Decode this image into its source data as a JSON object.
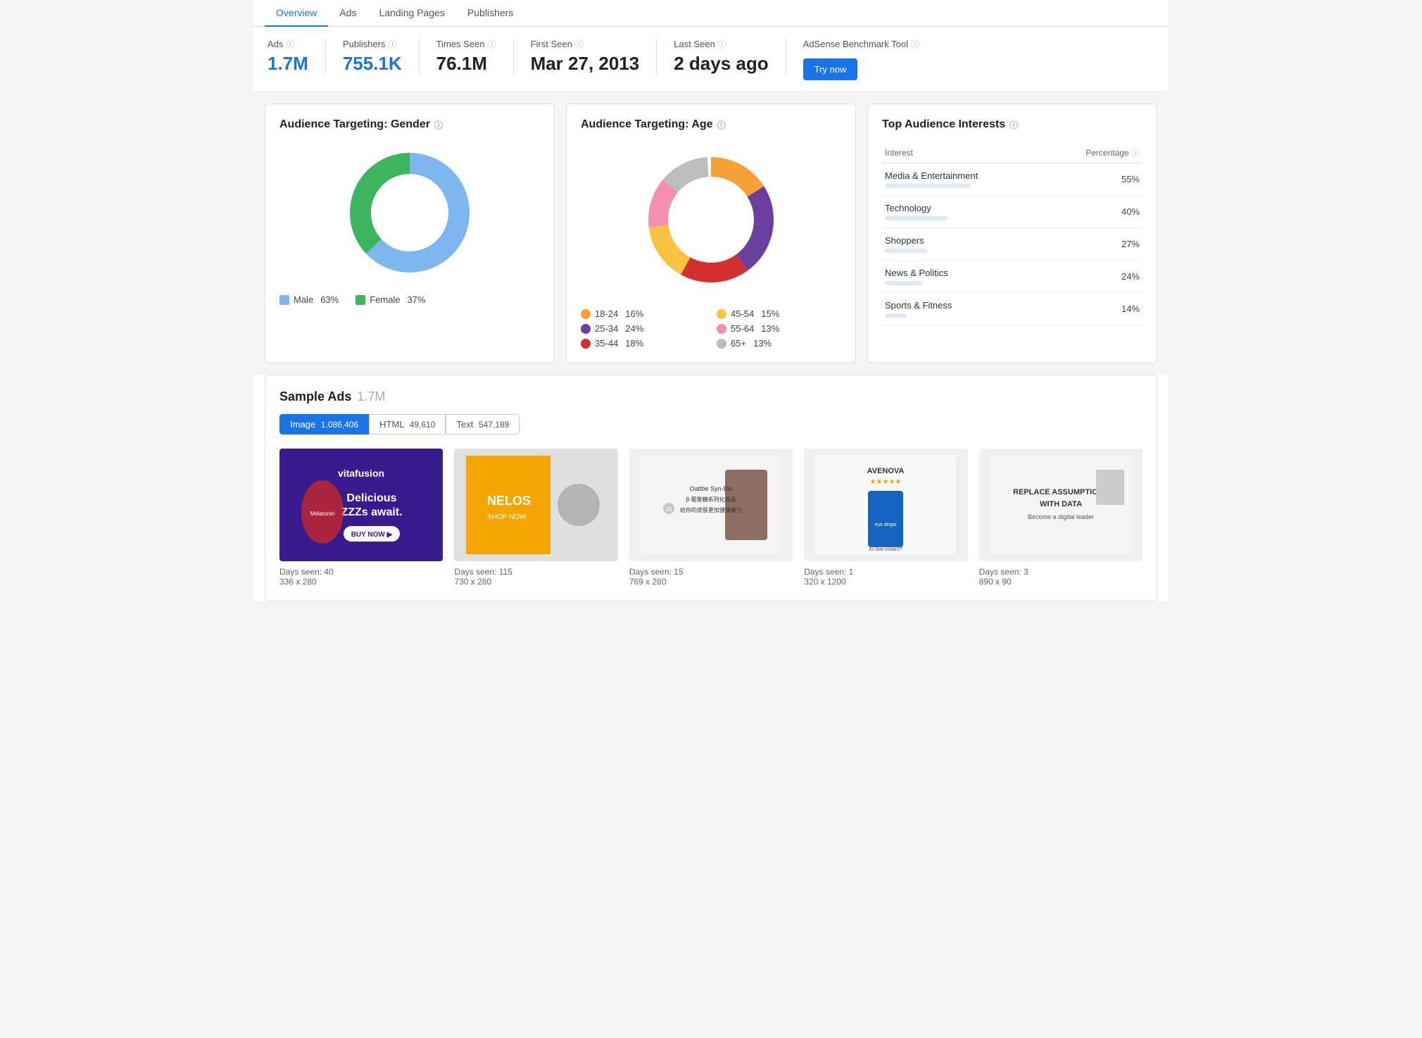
{
  "tabs": [
    {
      "id": "overview",
      "label": "Overview",
      "active": true
    },
    {
      "id": "ads",
      "label": "Ads",
      "active": false
    },
    {
      "id": "landing-pages",
      "label": "Landing Pages",
      "active": false
    },
    {
      "id": "publishers",
      "label": "Publishers",
      "active": false
    }
  ],
  "stats": {
    "ads": {
      "label": "Ads",
      "value": "1.7M"
    },
    "publishers": {
      "label": "Publishers",
      "value": "755.1K"
    },
    "times_seen": {
      "label": "Times Seen",
      "value": "76.1M"
    },
    "first_seen": {
      "label": "First Seen",
      "value": "Mar 27, 2013"
    },
    "last_seen": {
      "label": "Last Seen",
      "value": "2 days ago"
    },
    "adsense": {
      "label": "AdSense Benchmark Tool",
      "button": "Try now"
    }
  },
  "gender_chart": {
    "title": "Audience Targeting: Gender",
    "segments": [
      {
        "label": "Male",
        "pct": 63,
        "color": "#7eb6f0"
      },
      {
        "label": "Female",
        "pct": 37,
        "color": "#3db55e"
      }
    ]
  },
  "age_chart": {
    "title": "Audience Targeting: Age",
    "segments": [
      {
        "label": "18-24",
        "pct": 16,
        "color": "#f4a235"
      },
      {
        "label": "25-34",
        "pct": 24,
        "color": "#6b3fa0"
      },
      {
        "label": "35-44",
        "pct": 18,
        "color": "#d32f2f"
      },
      {
        "label": "45-54",
        "pct": 15,
        "color": "#f9c340"
      },
      {
        "label": "55-64",
        "pct": 13,
        "color": "#f48fb1"
      },
      {
        "label": "65+",
        "pct": 13,
        "color": "#bdbdbd"
      }
    ]
  },
  "interests": {
    "title": "Top Audience Interests",
    "col_interest": "Interest",
    "col_percentage": "Percentage",
    "items": [
      {
        "label": "Media & Entertainment",
        "pct": 55,
        "pct_label": "55%"
      },
      {
        "label": "Technology",
        "pct": 40,
        "pct_label": "40%"
      },
      {
        "label": "Shoppers",
        "pct": 27,
        "pct_label": "27%"
      },
      {
        "label": "News & Politics",
        "pct": 24,
        "pct_label": "24%"
      },
      {
        "label": "Sports & Fitness",
        "pct": 14,
        "pct_label": "14%"
      }
    ]
  },
  "sample_ads": {
    "title": "Sample Ads",
    "count": "1.7M",
    "filters": [
      {
        "label": "Image",
        "count": "1,086,406",
        "active": true
      },
      {
        "label": "HTML",
        "count": "49,610",
        "active": false
      },
      {
        "label": "Text",
        "count": "547,189",
        "active": false
      }
    ],
    "ads": [
      {
        "days_seen": "Days seen: 40",
        "dimensions": "336 x 280",
        "thumb_type": "vitafusion"
      },
      {
        "days_seen": "Days seen: 115",
        "dimensions": "730 x 280",
        "thumb_type": "gray"
      },
      {
        "days_seen": "Days seen: 15",
        "dimensions": "769 x 280",
        "thumb_type": "gray"
      },
      {
        "days_seen": "Days seen: 1",
        "dimensions": "320 x 1200",
        "thumb_type": "gray"
      },
      {
        "days_seen": "Days seen: 3",
        "dimensions": "890 x 90",
        "thumb_type": "gray"
      }
    ]
  }
}
